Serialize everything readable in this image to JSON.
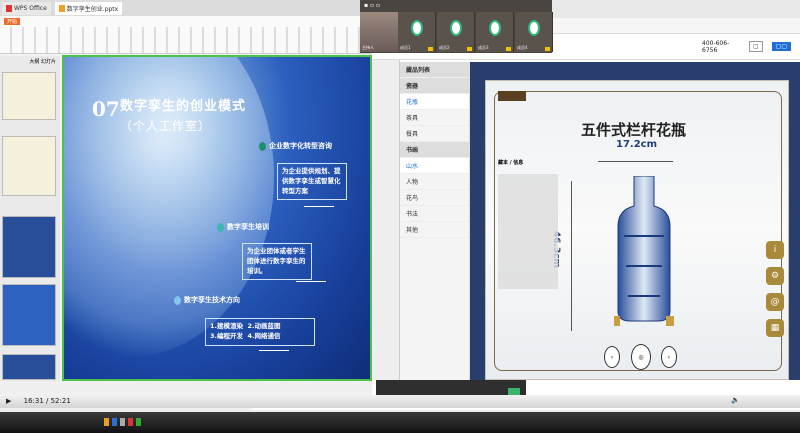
{
  "wps": {
    "tabs": [
      {
        "label": "WPS Office"
      },
      {
        "label": "数字孪生创业.pptx"
      }
    ],
    "ribbon_start": "开始",
    "thumb_tabs": [
      "大纲",
      "幻灯片"
    ]
  },
  "slide": {
    "number": "07",
    "title": "数字孪生的创业模式",
    "subtitle": "（个人工作室）",
    "items": [
      {
        "heading": "企业数字化转型咨询",
        "body": "为企业提供规划、提供数字孪生或智慧化转型方案",
        "dot": "#1e8f6a"
      },
      {
        "heading": "数字孪生培训",
        "body": "为企业团体或者学生团体进行数字孪生的培训。",
        "dot": "#3fb6b0"
      },
      {
        "heading": "数字孪生技术方向",
        "body": "1.建模渲染  2.动画蓝图\n3.编程开发  4.网络通信",
        "dot": "#7fc8e8"
      }
    ]
  },
  "meeting": {
    "participants": [
      "主持人",
      "成员1",
      "成员2",
      "成员3",
      "成员4"
    ]
  },
  "browser": {
    "phone": "400-606-6756",
    "sidebar": {
      "items": [
        {
          "label": "藏品列表",
          "type": "head"
        },
        {
          "label": "瓷器",
          "type": "head"
        },
        {
          "label": "花瓶",
          "type": "sel"
        },
        {
          "label": "茶具",
          "type": "item"
        },
        {
          "label": "餐具",
          "type": "item"
        },
        {
          "label": "书画",
          "type": "head"
        },
        {
          "label": "山水",
          "type": "sel"
        },
        {
          "label": "人物",
          "type": "item"
        },
        {
          "label": "花鸟",
          "type": "item"
        },
        {
          "label": "书法",
          "type": "item"
        },
        {
          "label": "其他",
          "type": "item"
        }
      ]
    },
    "vase": {
      "name": "五件式栏杆花瓶",
      "width": "17.2cm",
      "height": "46.3cm",
      "info_title": "藏本 / 信息",
      "side_buttons": [
        "i",
        "⚙",
        "@",
        "▦"
      ]
    }
  },
  "player": {
    "time": "16:31 / 52:21"
  }
}
